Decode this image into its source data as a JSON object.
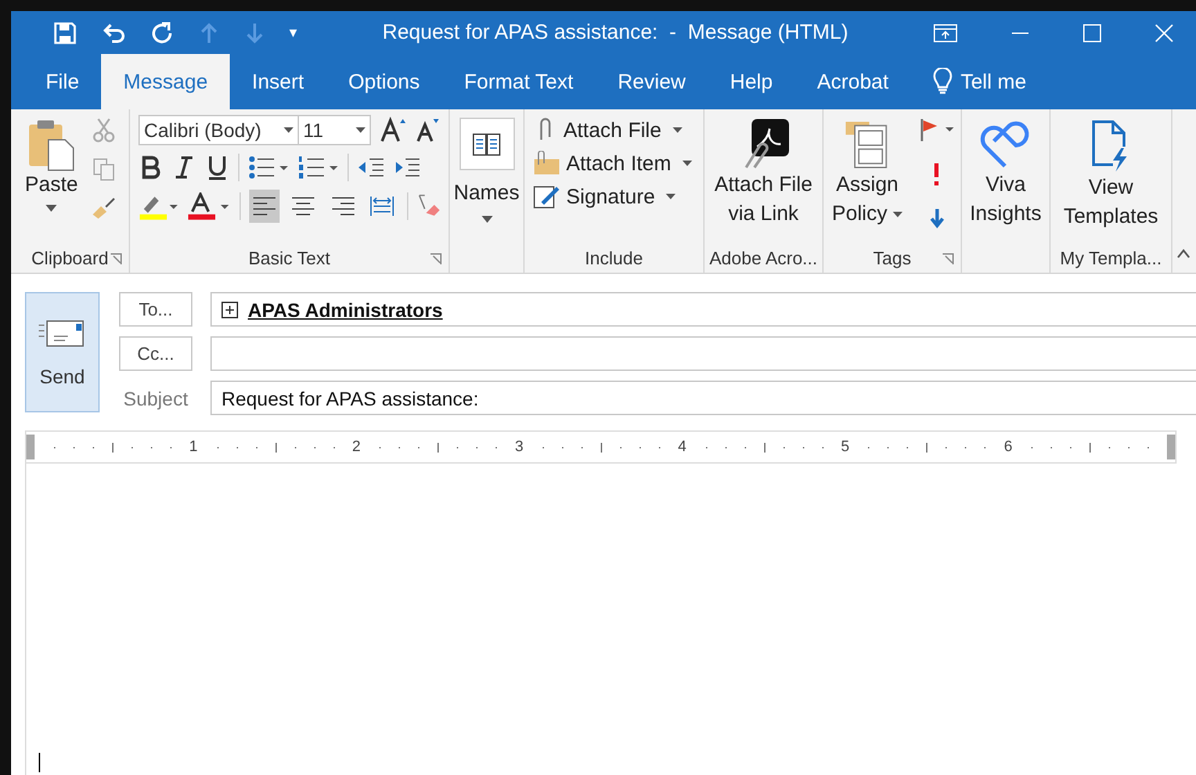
{
  "window": {
    "title": "Request for APAS assistance:  -  Message (HTML)"
  },
  "quick_access": {
    "menu_glyph": "▾"
  },
  "tabs": [
    {
      "label": "File",
      "selected": false
    },
    {
      "label": "Message",
      "selected": true
    },
    {
      "label": "Insert",
      "selected": false
    },
    {
      "label": "Options",
      "selected": false
    },
    {
      "label": "Format Text",
      "selected": false
    },
    {
      "label": "Review",
      "selected": false
    },
    {
      "label": "Help",
      "selected": false
    },
    {
      "label": "Acrobat",
      "selected": false
    }
  ],
  "tell_me": "Tell me",
  "ribbon": {
    "clipboard": {
      "paste": "Paste",
      "label": "Clipboard"
    },
    "basic_text": {
      "font": "Calibri (Body)",
      "size": "11",
      "label": "Basic Text",
      "alignments": [
        {
          "kind": "left",
          "selected": true
        },
        {
          "kind": "center",
          "selected": false
        },
        {
          "kind": "right",
          "selected": false
        },
        {
          "kind": "distributed",
          "selected": false
        }
      ]
    },
    "names": {
      "button": "Names"
    },
    "include": {
      "items": [
        "Attach File",
        "Attach Item",
        "Signature"
      ],
      "label": "Include"
    },
    "adobe": {
      "button_lines": [
        "Attach File",
        "via Link"
      ],
      "label": "Adobe Acro..."
    },
    "tags": {
      "button_lines": [
        "Assign",
        "Policy"
      ],
      "label": "Tags"
    },
    "viva": {
      "button_lines": [
        "Viva",
        "Insights"
      ]
    },
    "templates": {
      "button_lines": [
        "View",
        "Templates"
      ],
      "label": "My Templa..."
    }
  },
  "compose": {
    "send": "Send",
    "to_button": "To...",
    "to": "APAS Administrators",
    "cc_button": "Cc...",
    "subject_label": "Subject",
    "subject": "Request for APAS assistance:"
  },
  "ruler": {
    "numbers": [
      "1",
      "2",
      "3",
      "4",
      "5",
      "6"
    ]
  }
}
